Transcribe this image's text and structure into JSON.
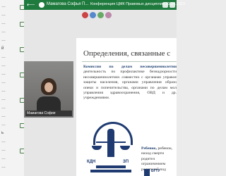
{
  "topbar": {
    "back_glyph": "⟵",
    "participant_name": "Мамагова Софья П...",
    "conference_title": "Конференция ЦМК Правовых дисциплин 20.04.2023",
    "accent": "#1f7a3e"
  },
  "sidebar": {
    "rows": [
      {
        "text": "…"
      },
      {
        "text": "…"
      },
      {
        "text": "…"
      },
      {
        "text": "й"
      },
      {
        "text": "…"
      },
      {
        "text": "…"
      },
      {
        "text": "…"
      },
      {
        "text": "…"
      },
      {
        "text": "…"
      },
      {
        "text": "…"
      },
      {
        "text": "…"
      },
      {
        "text": "…"
      },
      {
        "text": "…"
      },
      {
        "text": "ь"
      },
      {
        "text": "…"
      },
      {
        "text": "…"
      },
      {
        "text": "…"
      },
      {
        "text": "…"
      },
      {
        "text": "…"
      },
      {
        "text": "…"
      }
    ]
  },
  "video": {
    "name_label": "Мамагова София"
  },
  "slide": {
    "title": "Определения, связанные с",
    "body_bold": "Комиссия по делам несовершеннолетни",
    "body_rest": "деятельность по профилактике безнадзорности несовершеннолетних совместно с органами управле защиты населения, органами управления образо опеки и попечительства, органами по делам мол управления здравоохранения, ОВД и др. учреждениями.",
    "emblem_left": "КДН",
    "emblem_right": "ЗП",
    "right_bold": "Ребенок,",
    "right_rest": "ребенок, наход смерти родител ограничением родителей под",
    "logo_text": "БГТУ"
  }
}
